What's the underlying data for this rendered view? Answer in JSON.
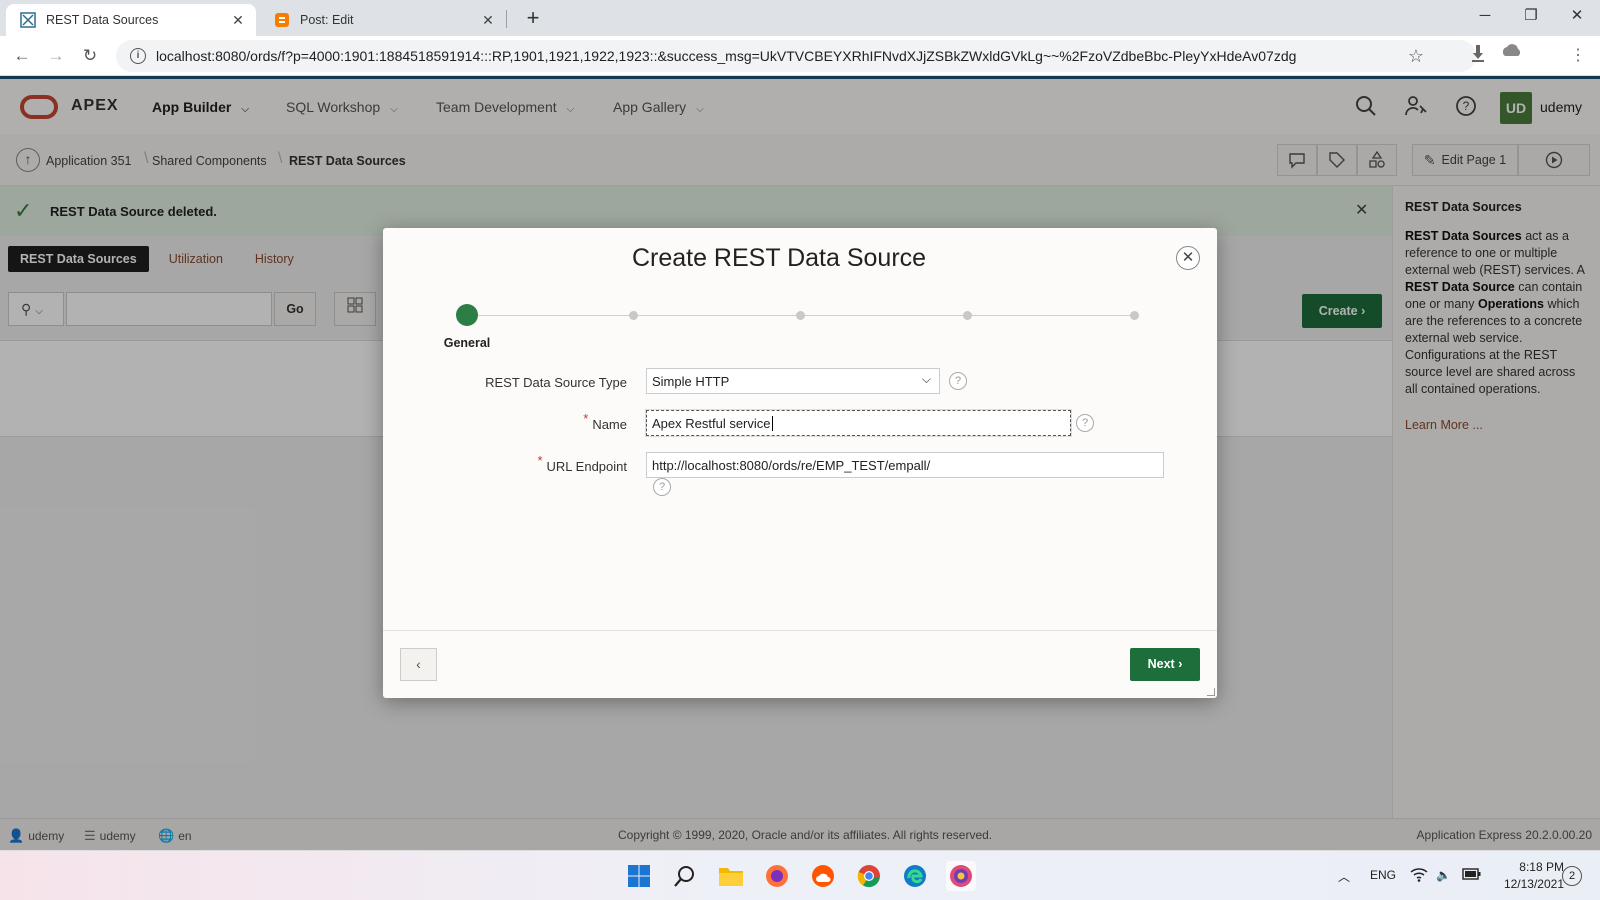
{
  "browser": {
    "tabs": [
      {
        "label": "REST Data Sources",
        "active": true,
        "favicon": "apex-favicon"
      },
      {
        "label": "Post: Edit",
        "active": false,
        "favicon": "blogger-favicon"
      }
    ],
    "url": "localhost:8080/ords/f?p=4000:1901:1884518591914:::RP,1901,1921,1922,1923::&success_msg=UkVTVCBEYXRhIFNvdXJjZSBkZWxldGVkLg~~%2FzoVZdbeBbc-PleyYxHdeAv07zdg"
  },
  "header": {
    "logo_text": "APEX",
    "menus": [
      {
        "label": "App Builder",
        "primary": true
      },
      {
        "label": "SQL Workshop",
        "primary": false
      },
      {
        "label": "Team Development",
        "primary": false
      },
      {
        "label": "App Gallery",
        "primary": false
      }
    ],
    "avatar_initials": "UD",
    "username": "udemy"
  },
  "breadcrumb": {
    "items": [
      "Application 351",
      "Shared Components",
      "REST Data Sources"
    ],
    "edit_page_label": "Edit Page 1"
  },
  "success": {
    "message": "REST Data Source deleted."
  },
  "page_tabs": [
    {
      "label": "REST Data Sources",
      "active": true
    },
    {
      "label": "Utilization",
      "active": false
    },
    {
      "label": "History",
      "active": false
    }
  ],
  "toolbar": {
    "go_label": "Go",
    "create_label": "Create"
  },
  "help_panel": {
    "title": "REST Data Sources",
    "learn_more": "Learn More ..."
  },
  "footer": {
    "user": "udemy",
    "workspace": "udemy",
    "language": "en",
    "copyright": "Copyright © 1999, 2020, Oracle and/or its affiliates. All rights reserved.",
    "version": "Application Express 20.2.0.00.20"
  },
  "dialog": {
    "title": "Create REST Data Source",
    "step_label": "General",
    "fields": {
      "type_label": "REST Data Source Type",
      "type_value": "Simple HTTP",
      "name_label": "Name",
      "name_value": "Apex Restful service",
      "url_label": "URL Endpoint",
      "url_value": "http://localhost:8080/ords/re/EMP_TEST/empall/"
    },
    "next_label": "Next"
  },
  "taskbar": {
    "language": "ENG",
    "time": "8:18 PM",
    "date": "12/13/2021",
    "notifications": "2"
  },
  "colors": {
    "accent_green": "#1e6e3c",
    "wizard_green": "#2d7d46",
    "oracle_red": "#c74634",
    "link_brown": "#8a4b2e"
  }
}
